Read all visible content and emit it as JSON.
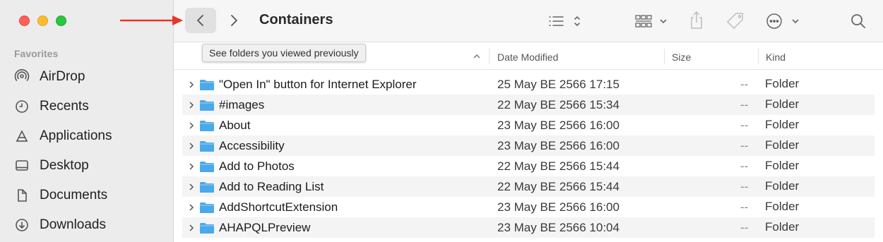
{
  "window": {
    "title": "Containers"
  },
  "sidebar": {
    "section": "Favorites",
    "items": [
      {
        "label": "AirDrop",
        "icon": "airdrop-icon"
      },
      {
        "label": "Recents",
        "icon": "clock-icon"
      },
      {
        "label": "Applications",
        "icon": "applications-icon"
      },
      {
        "label": "Desktop",
        "icon": "desktop-icon"
      },
      {
        "label": "Documents",
        "icon": "document-icon"
      },
      {
        "label": "Downloads",
        "icon": "download-icon"
      }
    ]
  },
  "tooltip": {
    "text": "See folders you viewed previously"
  },
  "columns": {
    "date": "Date Modified",
    "size": "Size",
    "kind": "Kind"
  },
  "rows": [
    {
      "name": "\"Open In\" button for Internet Explorer",
      "date": "25 May BE 2566 17:15",
      "size": "--",
      "kind": "Folder"
    },
    {
      "name": "#images",
      "date": "22 May BE 2566 15:34",
      "size": "--",
      "kind": "Folder"
    },
    {
      "name": "About",
      "date": "23 May BE 2566 16:00",
      "size": "--",
      "kind": "Folder"
    },
    {
      "name": "Accessibility",
      "date": "23 May BE 2566 16:00",
      "size": "--",
      "kind": "Folder"
    },
    {
      "name": "Add to Photos",
      "date": "22 May BE 2566 15:44",
      "size": "--",
      "kind": "Folder"
    },
    {
      "name": "Add to Reading List",
      "date": "22 May BE 2566 15:44",
      "size": "--",
      "kind": "Folder"
    },
    {
      "name": "AddShortcutExtension",
      "date": "23 May BE 2566 16:00",
      "size": "--",
      "kind": "Folder"
    },
    {
      "name": "AHAPQLPreview",
      "date": "23 May BE 2566 10:04",
      "size": "--",
      "kind": "Folder"
    }
  ],
  "colors": {
    "accent_folder": "#4aa9ea",
    "annotation_arrow": "#e8352a"
  }
}
